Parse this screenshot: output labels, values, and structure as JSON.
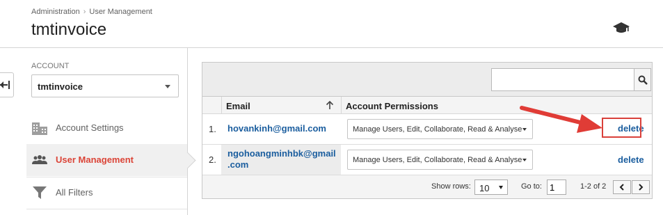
{
  "breadcrumb": {
    "parent": "Administration",
    "separator": "›",
    "current": "User Management"
  },
  "page_title": "tmtinvoice",
  "header_icons": {
    "help": "graduation-cap-icon"
  },
  "sidebar": {
    "account_label": "ACCOUNT",
    "account_value": "tmtinvoice",
    "items": [
      {
        "label": "Account Settings",
        "icon": "building-icon",
        "active": false
      },
      {
        "label": "User Management",
        "icon": "people-icon",
        "active": true
      },
      {
        "label": "All Filters",
        "icon": "filter-icon",
        "active": false
      }
    ]
  },
  "table": {
    "search": {
      "value": "",
      "placeholder": ""
    },
    "columns": {
      "email": "Email",
      "permissions": "Account Permissions"
    },
    "rows": [
      {
        "index": "1.",
        "email": "hovankinh@gmail.com",
        "permissions": "Manage Users, Edit, Collaborate, Read & Analyse",
        "action": "delete"
      },
      {
        "index": "2.",
        "email_line1": "ngohoangminhbk@gmail",
        "email_line2": ".com",
        "permissions": "Manage Users, Edit, Collaborate, Read & Analyse",
        "action": "delete"
      }
    ],
    "footer": {
      "show_rows_label": "Show rows:",
      "rows_value": "10",
      "goto_label": "Go to:",
      "goto_value": "1",
      "range": "1-2 of 2"
    }
  },
  "colors": {
    "accent_red": "#db4437",
    "link_blue": "#1a5d9e",
    "annotation_red": "#e03c36"
  }
}
